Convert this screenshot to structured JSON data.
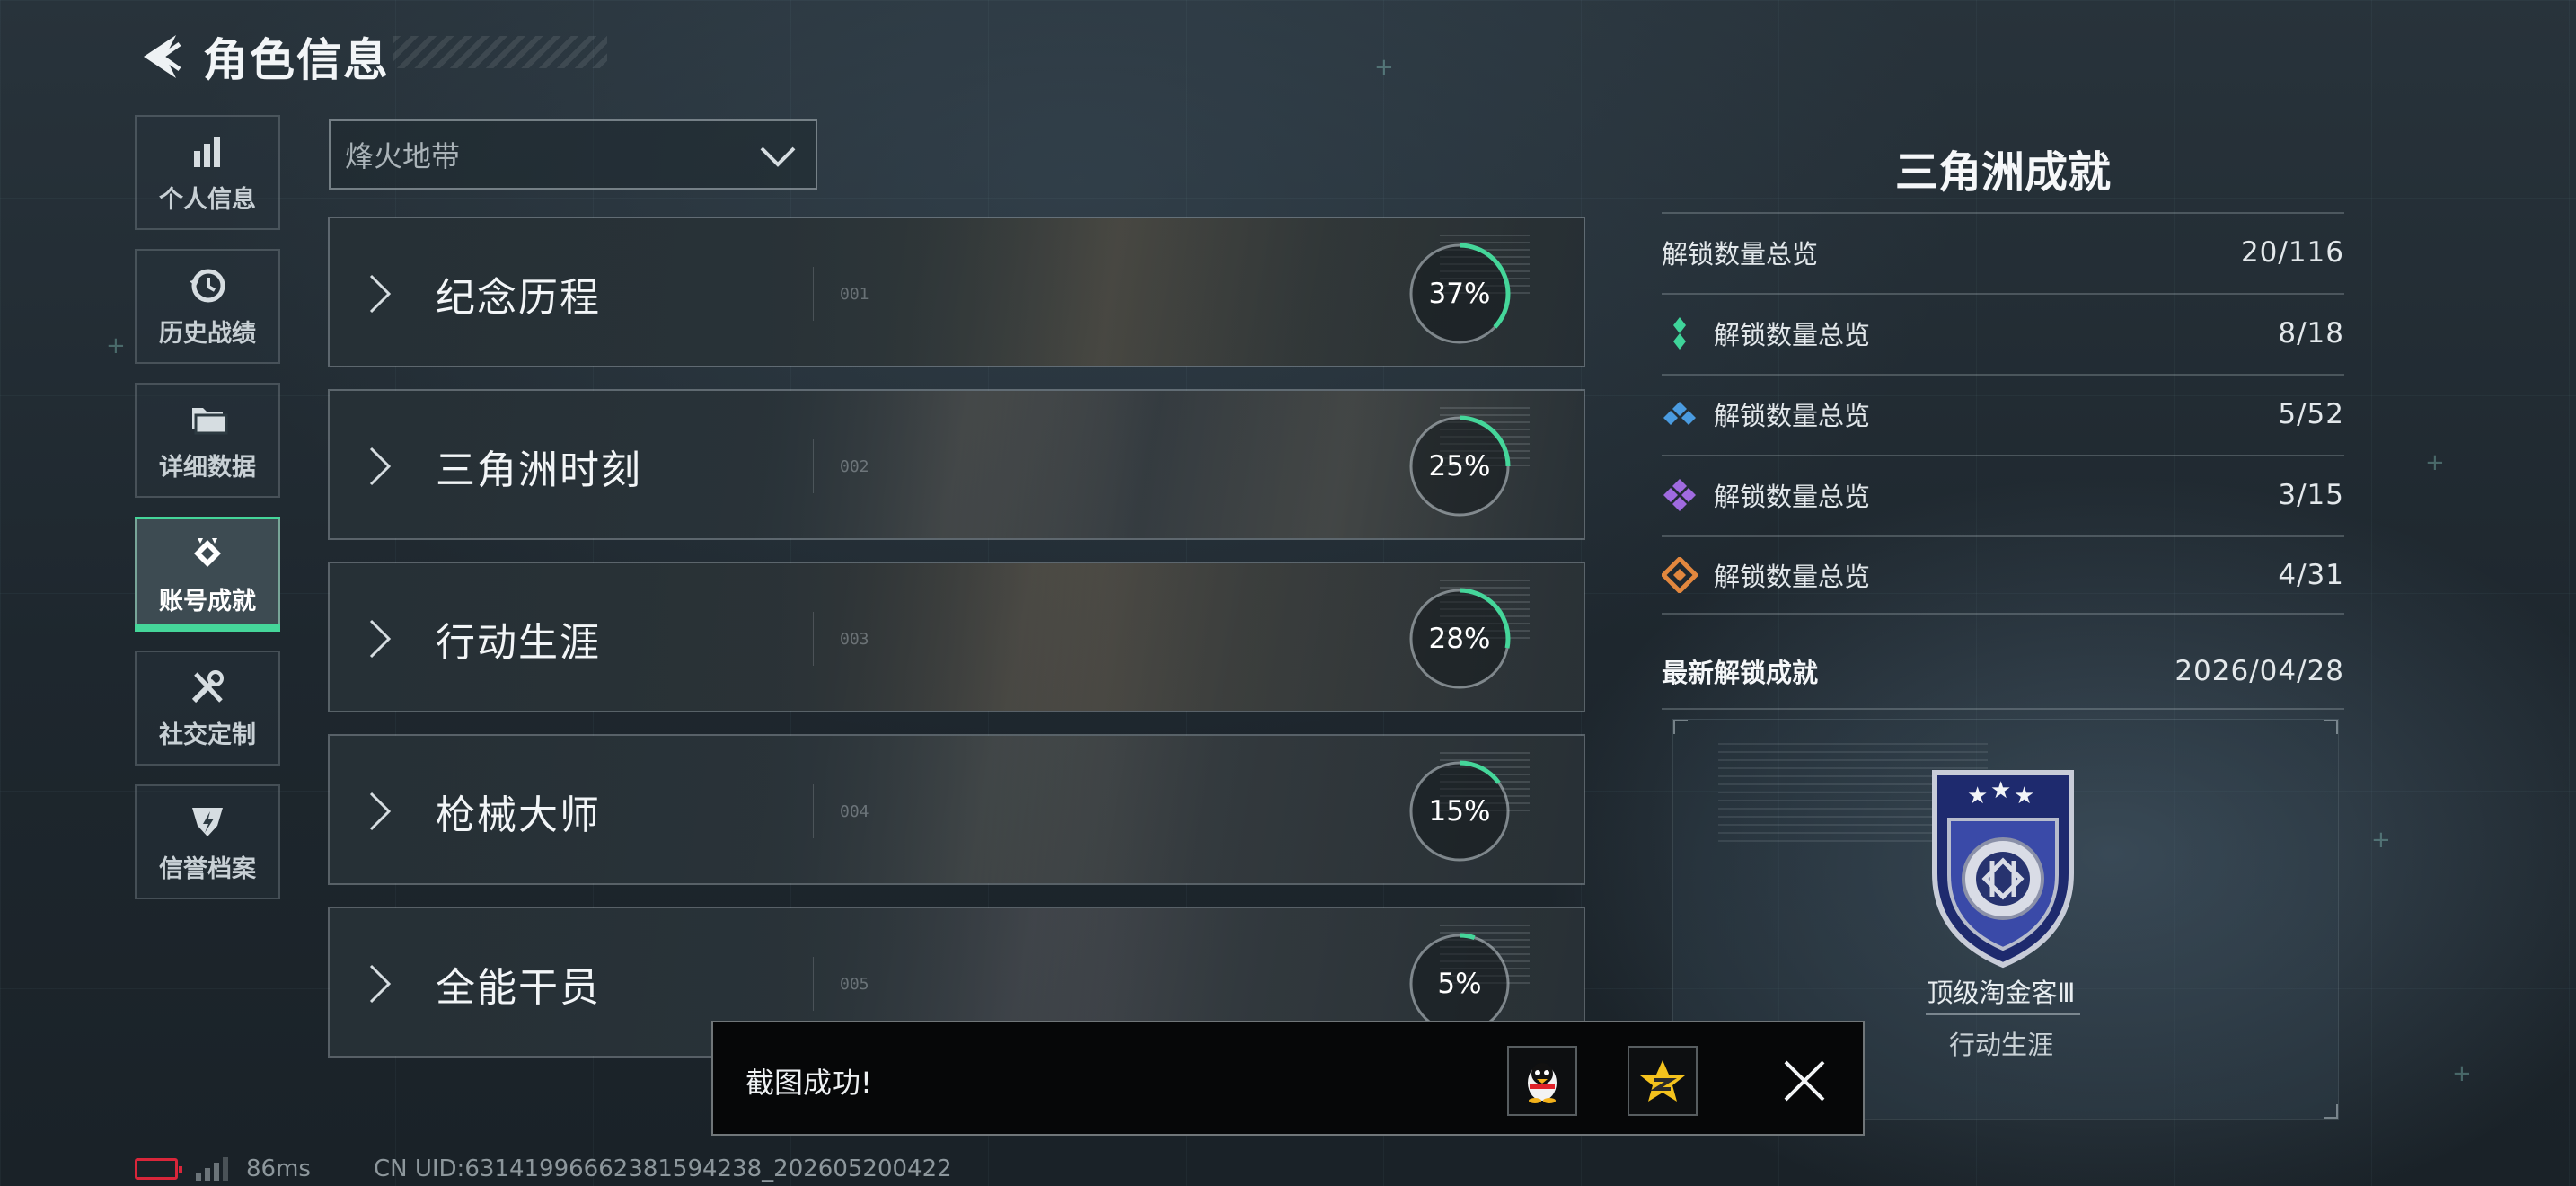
{
  "header": {
    "title": "角色信息"
  },
  "sidebar": {
    "items": [
      {
        "label": "个人信息",
        "icon": "bar-chart-icon",
        "active": false
      },
      {
        "label": "历史战绩",
        "icon": "history-icon",
        "active": false
      },
      {
        "label": "详细数据",
        "icon": "folder-icon",
        "active": false
      },
      {
        "label": "账号成就",
        "icon": "achievement-icon",
        "active": true
      },
      {
        "label": "社交定制",
        "icon": "tools-icon",
        "active": false
      },
      {
        "label": "信誉档案",
        "icon": "reputation-icon",
        "active": false
      }
    ]
  },
  "filter": {
    "selected": "烽火地带"
  },
  "categories": [
    {
      "name": "纪念历程",
      "code": "001",
      "percent": "37%",
      "progress": 0.37
    },
    {
      "name": "三角洲时刻",
      "code": "002",
      "percent": "25%",
      "progress": 0.25
    },
    {
      "name": "行动生涯",
      "code": "003",
      "percent": "28%",
      "progress": 0.28
    },
    {
      "name": "枪械大师",
      "code": "004",
      "percent": "15%",
      "progress": 0.15
    },
    {
      "name": "全能干员",
      "code": "005",
      "percent": "5%",
      "progress": 0.05
    }
  ],
  "panel": {
    "title": "三角洲成就",
    "overview": {
      "label": "解锁数量总览",
      "value": "20/116"
    },
    "tiers": [
      {
        "label": "解锁数量总览",
        "value": "8/18",
        "icon": "green-gem-icon",
        "color": "#3fd49a"
      },
      {
        "label": "解锁数量总览",
        "value": "5/52",
        "icon": "blue-gem-icon",
        "color": "#4a9be0"
      },
      {
        "label": "解锁数量总览",
        "value": "3/15",
        "icon": "purple-gem-icon",
        "color": "#a06ae0"
      },
      {
        "label": "解锁数量总览",
        "value": "4/31",
        "icon": "orange-gem-icon",
        "color": "#e2873e"
      }
    ],
    "latest": {
      "label": "最新解锁成就",
      "date": "2026/04/28"
    },
    "badge": {
      "name": "顶级淘金客Ⅲ",
      "category": "行动生涯"
    }
  },
  "toast": {
    "message": "截图成功!"
  },
  "footer": {
    "ping": "86ms",
    "uid": "CN UID:63141996662381594238_202605200422"
  },
  "colors": {
    "accent": "#45d69a",
    "battery": "#d9263a",
    "toast_bg": "#060708"
  }
}
